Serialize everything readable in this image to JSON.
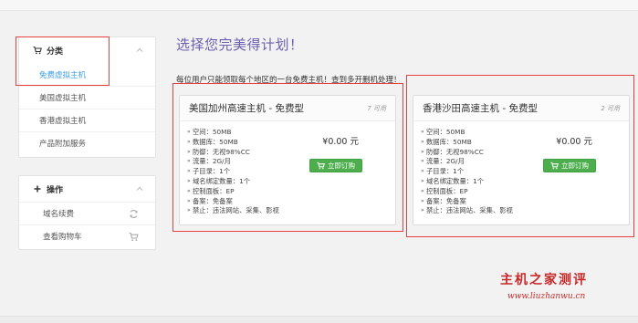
{
  "sidebar": {
    "category": {
      "header": "分类",
      "items": [
        {
          "label": "免费虚拟主机",
          "active": true
        },
        {
          "label": "美国虚拟主机",
          "active": false
        },
        {
          "label": "香港虚拟主机",
          "active": false
        },
        {
          "label": "产品附加服务",
          "active": false
        }
      ]
    },
    "actions": {
      "header": "操作",
      "items": [
        {
          "label": "域名续费",
          "icon": "refresh-icon"
        },
        {
          "label": "查看购物车",
          "icon": "cart-icon"
        }
      ]
    }
  },
  "main": {
    "title": "选择您完美得计划！",
    "notice": "每位用户只能领取每个地区的一台免费主机！查到多开删机处理！",
    "products": [
      {
        "name": "美国加州高速主机 - 免费型",
        "available": "7 可用",
        "price": "¥0.00 元",
        "button": "立即订购",
        "features": [
          "空间：50MB",
          "数据库：50MB",
          "防御：无视98%CC",
          "流量：2G/月",
          "子目录：1个",
          "域名绑定数量：1个",
          "控制面板：EP",
          "备案：免备案",
          "禁止：违法网站、采集、影视"
        ]
      },
      {
        "name": "香港沙田高速主机 - 免费型",
        "available": "2 可用",
        "price": "¥0.00 元",
        "button": "立即订购",
        "features": [
          "空间：50MB",
          "数据库：50MB",
          "防御：无视98%CC",
          "流量：2G/月",
          "子目录：1个",
          "域名绑定数量：1个",
          "控制面板：EP",
          "备案：免备案",
          "禁止：违法网站、采集、影视"
        ]
      }
    ]
  },
  "watermark": {
    "title": "主机之家测评",
    "url": "www.liuzhanwu.cn"
  },
  "colors": {
    "accent_blue": "#3a9ee8",
    "title_purple": "#6a5fb0",
    "button_green": "#4cae4c",
    "highlight_red": "#e64040"
  }
}
